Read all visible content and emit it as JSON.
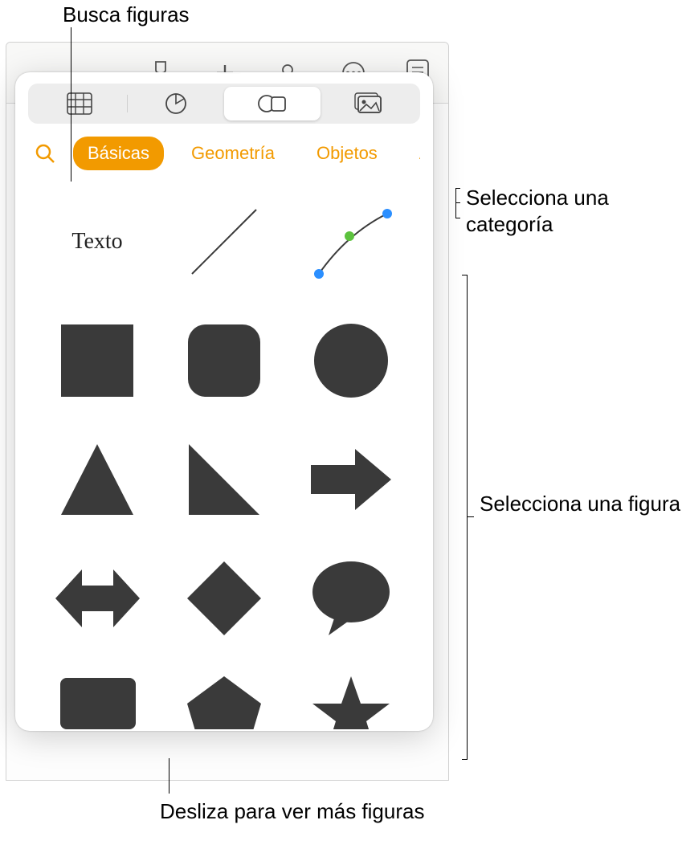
{
  "callouts": {
    "search": "Busca figuras",
    "category": "Selecciona una categoría",
    "shape": "Selecciona una figura",
    "swipe": "Desliza para ver más figuras"
  },
  "toolbar": {
    "items": [
      "format-brush",
      "insert",
      "collaborate",
      "more",
      "document-view"
    ]
  },
  "insert_tabs": {
    "items": [
      "tables",
      "charts",
      "shapes",
      "media"
    ],
    "active_index": 2
  },
  "categories": {
    "active_index": 0,
    "items": [
      "Básicas",
      "Geometría",
      "Objetos",
      "Ar"
    ]
  },
  "shapes": {
    "text_label": "Texto",
    "items": [
      "text",
      "line",
      "curve",
      "square",
      "rounded-square",
      "circle",
      "triangle",
      "right-triangle",
      "arrow-right",
      "arrow-leftright",
      "diamond",
      "speech-bubble",
      "chat-bubble",
      "pentagon",
      "star"
    ]
  }
}
